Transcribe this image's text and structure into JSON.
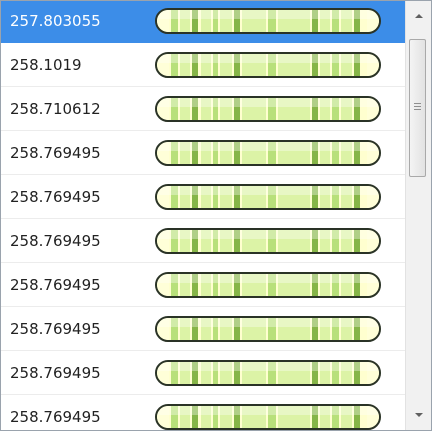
{
  "list": {
    "selected_index": 0,
    "items": [
      {
        "value": "257.803055"
      },
      {
        "value": "258.1019"
      },
      {
        "value": "258.710612"
      },
      {
        "value": "258.769495"
      },
      {
        "value": "258.769495"
      },
      {
        "value": "258.769495"
      },
      {
        "value": "258.769495"
      },
      {
        "value": "258.769495"
      },
      {
        "value": "258.769495"
      },
      {
        "value": "258.769495"
      }
    ],
    "band_icon": "chromosome-band-icon"
  },
  "colors": {
    "selection": "#3c8de8",
    "band_light": "#dcf3a6",
    "band_mid": "#b8e07a",
    "band_dark": "#86b548",
    "cap": "#ffffd8",
    "outline": "#2a3326"
  },
  "scrollbar": {
    "up_icon": "arrow-up-icon",
    "down_icon": "arrow-down-icon",
    "thumb_grip_icon": "grip-icon"
  }
}
